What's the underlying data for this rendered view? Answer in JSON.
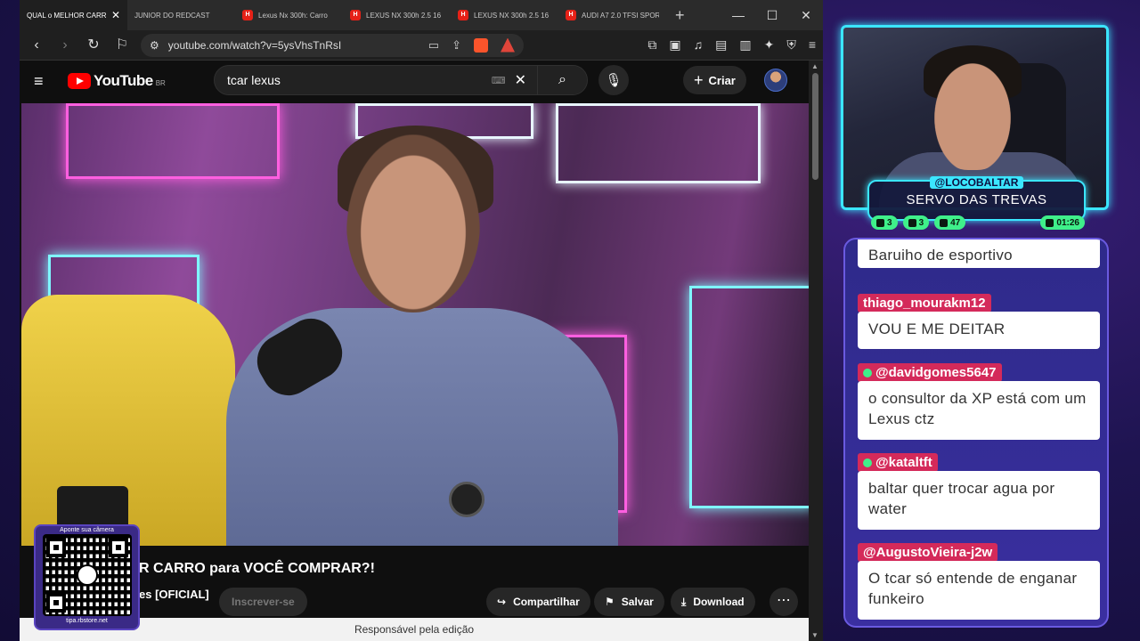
{
  "browser": {
    "tabs": [
      {
        "label": "QUAL o MELHOR CARRO",
        "active": true,
        "icon": "youtube-icon"
      },
      {
        "label": "JUNIOR DO REDCAST",
        "active": false,
        "icon": "youtube-icon"
      },
      {
        "label": "Lexus Nx 300h: Carro",
        "active": false,
        "icon": "site-icon"
      },
      {
        "label": "LEXUS NX 300h 2.5 16",
        "active": false,
        "icon": "site-icon"
      },
      {
        "label": "LEXUS NX 300h 2.5 16",
        "active": false,
        "icon": "site-icon"
      },
      {
        "label": "AUDI A7 2.0 TFSI SPOR",
        "active": false,
        "icon": "site-icon"
      }
    ],
    "url": "youtube.com/watch?v=5ysVhsTnRsI"
  },
  "youtube": {
    "logo_text": "YouTube",
    "country": "BR",
    "search_value": "tcar lexus",
    "create_label": "Criar",
    "video_title": "R CARRO para VOCÊ COMPRAR?!",
    "channel_name": "es [OFICIAL]",
    "subscribe_label": "Inscrever-se",
    "share_label": "Compartilhar",
    "save_label": "Salvar",
    "download_label": "Download",
    "footer_text": "Responsável pela edição"
  },
  "qr": {
    "top_text": "Aponte sua câmera",
    "bottom_text": "tipa.rbstore.net"
  },
  "stream": {
    "handle": "@LOCOBALTAR",
    "title": "SERVO DAS TREVAS",
    "stats": [
      "3",
      "3",
      "47",
      "01:26"
    ]
  },
  "chat": [
    {
      "user": "",
      "text": "Baruiho de esportivo"
    },
    {
      "user": "thiago_mourakm12",
      "text": "VOU E ME DEITAR"
    },
    {
      "user": "@davidgomes5647",
      "text": "o consultor da XP está com um Lexus ctz"
    },
    {
      "user": "@kataltft",
      "text": "baltar quer trocar agua por water"
    },
    {
      "user": "@AugustoVieira-j2w",
      "text": "O tcar só entende de enganar funkeiro"
    }
  ],
  "colors": {
    "youtube_red": "#ff0000",
    "neon_cyan": "#3be6ff",
    "chat_user_bg": "#d42a5a",
    "stat_green": "#3ff08a"
  }
}
